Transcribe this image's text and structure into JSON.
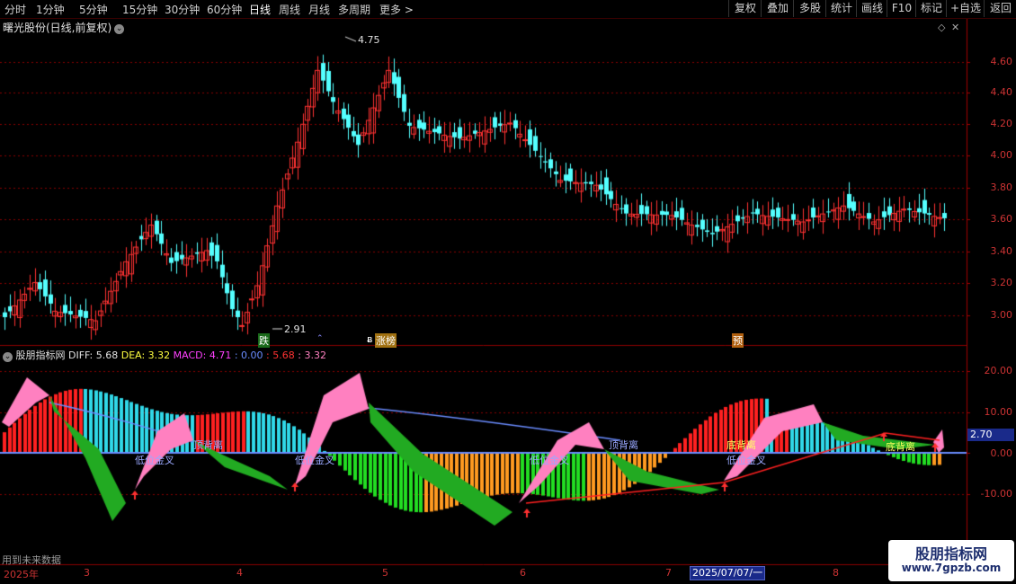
{
  "toolbar": {
    "periods": [
      "分时",
      "1分钟",
      "5分钟",
      "15分钟",
      "30分钟",
      "60分钟",
      "日线",
      "周线",
      "月线",
      "多周期",
      "更多 >"
    ],
    "active_period": "日线",
    "buttons": [
      "复权",
      "叠加",
      "多股",
      "统计",
      "画线",
      "F10",
      "标记",
      "+自选",
      "返回"
    ]
  },
  "chart": {
    "title": "曙光股份(日线,前复权)",
    "price_ticks": [
      "4.60",
      "4.40",
      "4.20",
      "4.00",
      "3.80",
      "3.60",
      "3.40",
      "3.20",
      "3.00"
    ],
    "high_label": "4.75",
    "low_label": "2.91",
    "signals": [
      "跌",
      "涨榜",
      "预"
    ],
    "indicator_name": "股朋指标网",
    "diff": "DIFF: 5.68",
    "dea": "DEA: 3.32",
    "macd": "MACD: 4.71",
    "m1": ": 0.00",
    "m2": ": 5.68",
    "m3": ": 3.32",
    "sub_ticks": [
      "20.00",
      "10.00",
      "0.00",
      "-10.00"
    ],
    "current_value": "2.70",
    "labels": [
      "顶背离",
      "低位金叉",
      "低位金叉",
      "低位金叉",
      "顶背离",
      "底背离",
      "低位金叉",
      "底背离"
    ],
    "footer_note": "用到未来数据",
    "dates": [
      "2025年",
      "3",
      "4",
      "5",
      "6",
      "7",
      "8"
    ],
    "cursor_date": "2025/07/07/一",
    "site_name": "股朋指标网",
    "site_url": "www.7gpzb.com"
  },
  "colors": {
    "up": "#ff3232",
    "down": "#54ffff",
    "grid": "#8a0000",
    "pink": "#ff80c0",
    "green": "#22aa22",
    "blue": "#6a8cff"
  }
}
